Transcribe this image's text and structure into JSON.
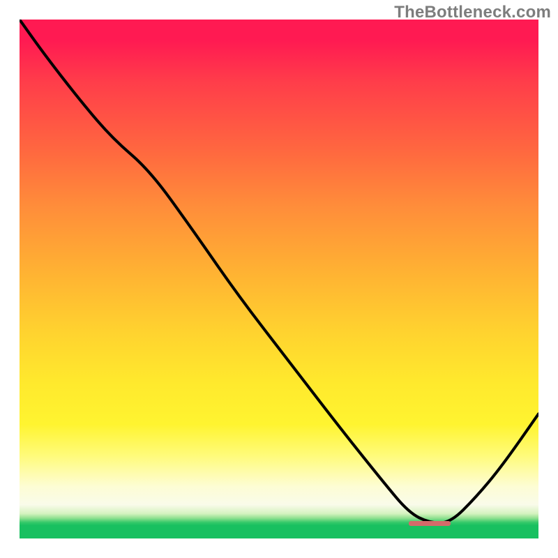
{
  "watermark": "TheBottleneck.com",
  "colors": {
    "curve": "#000000",
    "flat_marker": "#d46a6a",
    "gradient_top": "#ff1a52",
    "gradient_mid": "#ffd22f",
    "gradient_low": "#fffb7a",
    "gradient_green": "#18c060"
  },
  "chart_data": {
    "type": "line",
    "title": "",
    "xlabel": "",
    "ylabel": "",
    "xlim": [
      0,
      100
    ],
    "ylim": [
      0,
      100
    ],
    "note": "x/y are percent of plot area; y measured from top. Line descends from upper-left with a slope change near x≈25, reaches a flat minimum around x≈75–83 at y≈97, then rises toward the right edge.",
    "series": [
      {
        "name": "curve",
        "x": [
          0,
          5,
          12,
          18,
          25,
          33,
          42,
          52,
          62,
          70,
          75,
          79,
          83,
          88,
          93,
          100
        ],
        "y": [
          0,
          7,
          16,
          23,
          29,
          40,
          53,
          66,
          79,
          89,
          95,
          97,
          97,
          92,
          86,
          76
        ]
      }
    ],
    "flat_segment": {
      "x_start": 75,
      "x_end": 83,
      "y": 97
    }
  }
}
